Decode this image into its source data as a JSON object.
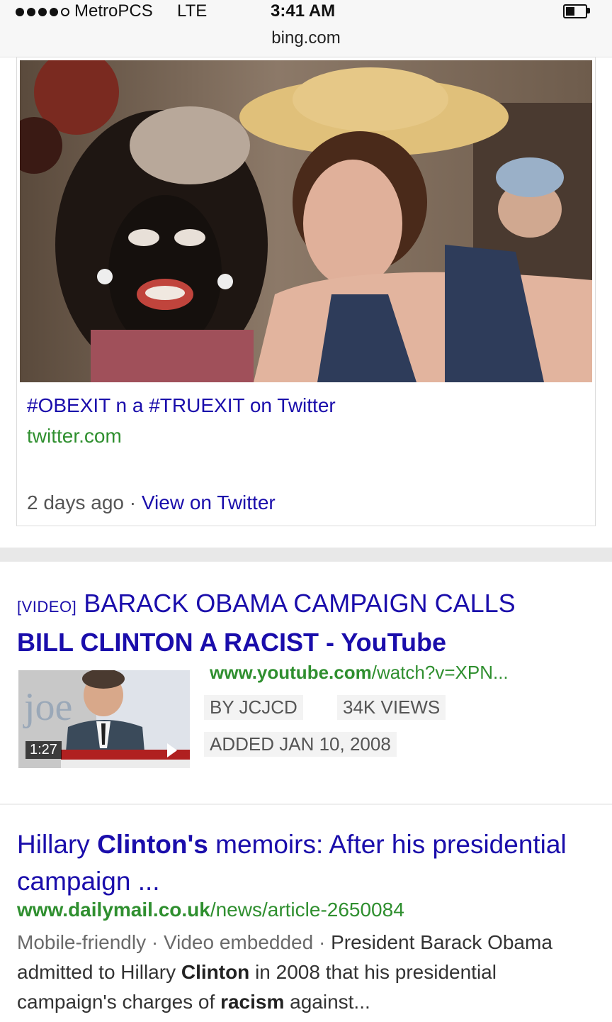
{
  "status_bar": {
    "carrier": "MetroPCS",
    "network": "LTE",
    "time": "3:41 AM"
  },
  "address_bar": {
    "url": "bing.com"
  },
  "tweet_card": {
    "title": "#OBEXIT n a #TRUEXIT on Twitter",
    "domain": "twitter.com",
    "age": "2 days ago",
    "separator": " · ",
    "view_link": "View on Twitter"
  },
  "video_result": {
    "tag": "[VIDEO]",
    "title_part1": " BARACK OBAMA CAMPAIGN CALLS",
    "title_part2": "BILL CLINTON A RACIST",
    "title_part3": " - YouTube",
    "url_domain": "www.youtube.com",
    "url_path": "/watch?v=XPN...",
    "by": "BY JCJCD",
    "views": "34K VIEWS",
    "added": "ADDED JAN 10, 2008",
    "duration": "1:27"
  },
  "dailymail_result": {
    "title_a": "Hillary ",
    "title_b": "Clinton's",
    "title_c": " memoirs: After his presidential campaign ...",
    "url_domain": "www.dailymail.co.uk",
    "url_path": "/news/article-2650084",
    "meta_1": "Mobile-friendly",
    "meta_2": "Video embedded",
    "sep": " · ",
    "snip_1": "President Barack Obama admitted to Hillary ",
    "snip_b1": "Clinton",
    "snip_2": " in 2008 that his presidential campaign's charges of ",
    "snip_b2": "racism",
    "snip_3": " against..."
  },
  "colors": {
    "link": "#1a0dab",
    "url_green": "#2f8f2f"
  }
}
